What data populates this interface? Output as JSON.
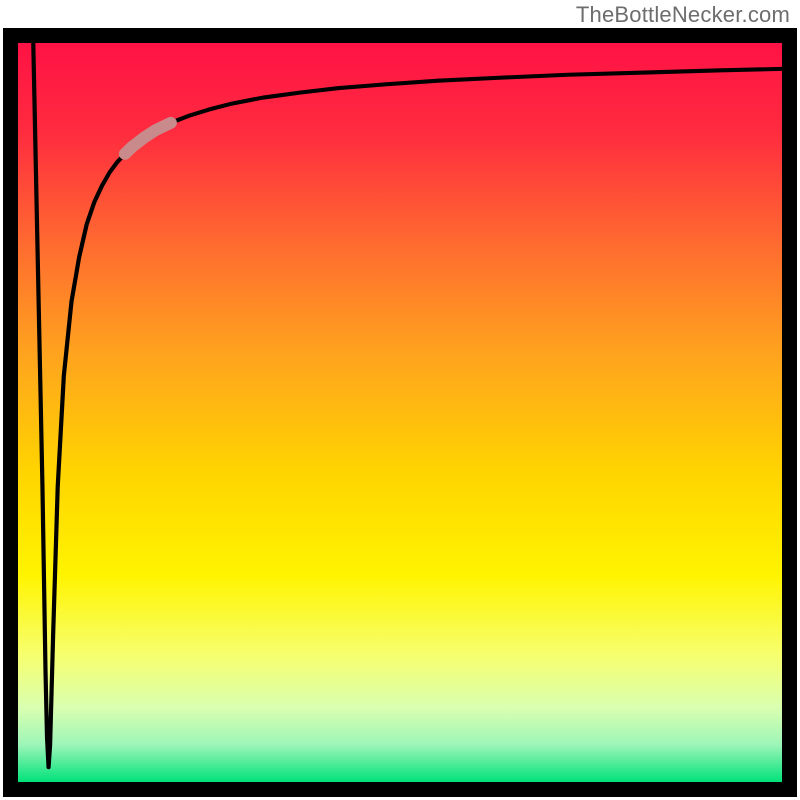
{
  "attribution": "TheBottleNecker.com",
  "chart_data": {
    "type": "line",
    "title": "",
    "xlabel": "",
    "ylabel": "",
    "xlim": [
      0,
      100
    ],
    "ylim": [
      0,
      100
    ],
    "series": [
      {
        "name": "curve",
        "x": [
          2.0,
          2.6,
          3.2,
          3.6,
          3.8,
          4.0,
          4.2,
          4.6,
          5.2,
          6.0,
          7.0,
          8.0,
          9.0,
          10.0,
          11.0,
          12.0,
          13.0,
          14.0,
          15.0,
          16.5,
          18.0,
          20.0,
          22.5,
          25.0,
          28.0,
          32.0,
          37.0,
          42.0,
          48.0,
          55.0,
          63.0,
          72.0,
          82.0,
          92.0,
          100.0
        ],
        "y": [
          100.0,
          70.0,
          40.0,
          15.0,
          6.0,
          2.0,
          5.0,
          20.0,
          40.0,
          55.0,
          65.0,
          71.0,
          75.5,
          78.5,
          80.7,
          82.5,
          83.9,
          85.0,
          86.0,
          87.2,
          88.2,
          89.2,
          90.2,
          91.0,
          91.8,
          92.6,
          93.3,
          93.9,
          94.4,
          94.9,
          95.3,
          95.7,
          96.0,
          96.3,
          96.5
        ]
      }
    ],
    "highlight": {
      "x_start": 14.0,
      "x_end": 20.0,
      "color": "#c98a8c",
      "stroke_width": 1.6
    },
    "curve_style": {
      "color": "#000000",
      "stroke_width": 0.55
    },
    "background_gradient": {
      "stops": [
        {
          "offset": 0.0,
          "color": "#ff1245"
        },
        {
          "offset": 0.12,
          "color": "#ff2b3f"
        },
        {
          "offset": 0.27,
          "color": "#ff6a30"
        },
        {
          "offset": 0.42,
          "color": "#ffa31e"
        },
        {
          "offset": 0.58,
          "color": "#ffd400"
        },
        {
          "offset": 0.72,
          "color": "#fff400"
        },
        {
          "offset": 0.83,
          "color": "#f6ff70"
        },
        {
          "offset": 0.9,
          "color": "#d9ffb0"
        },
        {
          "offset": 0.95,
          "color": "#9cf5b8"
        },
        {
          "offset": 1.0,
          "color": "#00e27a"
        }
      ]
    }
  }
}
